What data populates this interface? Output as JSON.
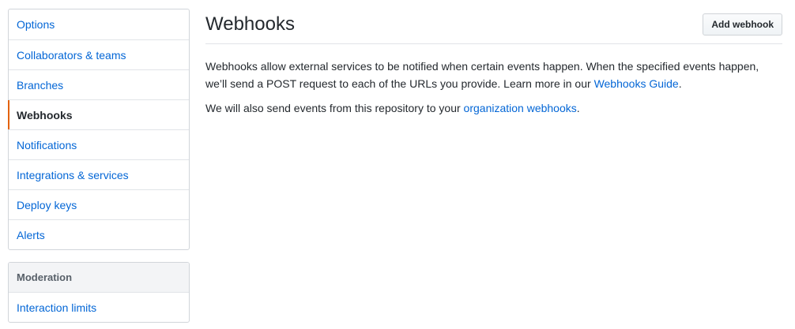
{
  "sidebar": {
    "menu": [
      {
        "label": "Options",
        "name": "sidebar-item-options"
      },
      {
        "label": "Collaborators & teams",
        "name": "sidebar-item-collaborators-teams"
      },
      {
        "label": "Branches",
        "name": "sidebar-item-branches"
      },
      {
        "label": "Webhooks",
        "name": "sidebar-item-webhooks",
        "selected": true
      },
      {
        "label": "Notifications",
        "name": "sidebar-item-notifications"
      },
      {
        "label": "Integrations & services",
        "name": "sidebar-item-integrations-services"
      },
      {
        "label": "Deploy keys",
        "name": "sidebar-item-deploy-keys"
      },
      {
        "label": "Alerts",
        "name": "sidebar-item-alerts"
      }
    ],
    "moderation": {
      "heading": "Moderation",
      "items": [
        {
          "label": "Interaction limits",
          "name": "sidebar-item-interaction-limits"
        }
      ]
    }
  },
  "main": {
    "title": "Webhooks",
    "add_button": "Add webhook",
    "paragraph1": {
      "text": "Webhooks allow external services to be notified when certain events happen. When the specified events happen, we’ll send a POST request to each of the URLs you provide. Learn more in our ",
      "link": "Webhooks Guide",
      "suffix": "."
    },
    "paragraph2": {
      "text": "We will also send events from this repository to your ",
      "link": "organization webhooks",
      "suffix": "."
    }
  },
  "colors": {
    "link": "#0366d6",
    "selected_indicator": "#e36209",
    "border": "#d1d5da",
    "text": "#24292e"
  }
}
